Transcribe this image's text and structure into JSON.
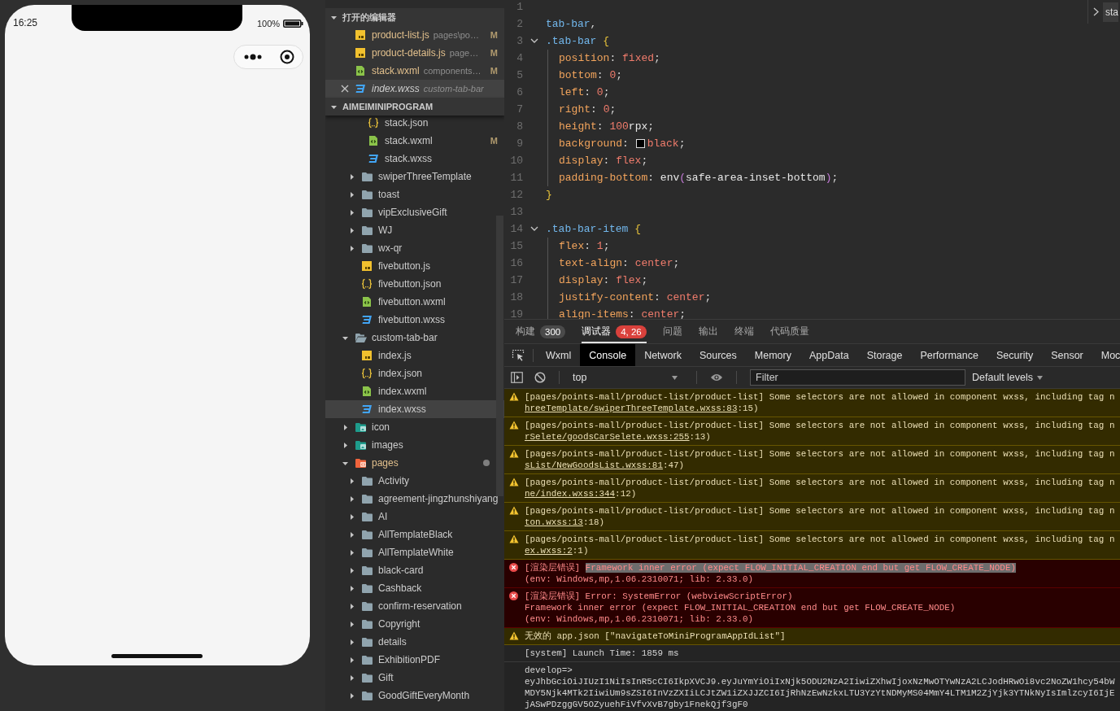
{
  "simulator": {
    "time": "16:25",
    "battery": "100%"
  },
  "explorer": {
    "open_editors": {
      "title": "打开的编辑器",
      "expanded": true,
      "files": [
        {
          "name": "product-list.js",
          "path": "pages\\po…",
          "kind": "js",
          "status": "M",
          "preview": false,
          "selected": false
        },
        {
          "name": "product-details.js",
          "path": "page…",
          "kind": "js",
          "status": "M",
          "preview": false,
          "selected": false
        },
        {
          "name": "stack.wxml",
          "path": "components…",
          "kind": "wxml",
          "status": "M",
          "preview": false,
          "selected": false
        },
        {
          "name": "index.wxss",
          "path": "custom-tab-bar",
          "kind": "wxss",
          "preview": true,
          "selected": true
        }
      ]
    },
    "project": {
      "title": "AIMEIMINIPROGRAM",
      "expanded": true,
      "tree": [
        {
          "children": [
            {
              "children": [
                {
                  "name": "stack.json",
                  "kind": "json",
                  "selected": false
                },
                {
                  "name": "stack.wxml",
                  "kind": "wxml",
                  "status": "M",
                  "selected": false
                },
                {
                  "name": "stack.wxss",
                  "kind": "wxss",
                  "selected": false
                }
              ]
            },
            {
              "name": "swiperThreeTemplate",
              "kind": "folder",
              "expanded": false,
              "selected": false
            },
            {
              "name": "toast",
              "kind": "folder",
              "expanded": false,
              "selected": false
            },
            {
              "name": "vipExclusiveGift",
              "kind": "folder",
              "expanded": false,
              "selected": false
            },
            {
              "name": "WJ",
              "kind": "folder",
              "expanded": false,
              "selected": false
            },
            {
              "name": "wx-qr",
              "kind": "folder",
              "expanded": false,
              "selected": false
            },
            {
              "name": "fivebutton.js",
              "kind": "js",
              "selected": false
            },
            {
              "name": "fivebutton.json",
              "kind": "json",
              "selected": false
            },
            {
              "name": "fivebutton.wxml",
              "kind": "wxml",
              "selected": false
            },
            {
              "name": "fivebutton.wxss",
              "kind": "wxss",
              "selected": false
            }
          ]
        },
        {
          "name": "custom-tab-bar",
          "kind": "folder",
          "expanded": true,
          "selected": false,
          "children": [
            {
              "name": "index.js",
              "kind": "js",
              "selected": false
            },
            {
              "name": "index.json",
              "kind": "json",
              "selected": false
            },
            {
              "name": "index.wxml",
              "kind": "wxml",
              "selected": false
            },
            {
              "name": "index.wxss",
              "kind": "wxss",
              "selected": true
            }
          ]
        },
        {
          "name": "icon",
          "kind": "folder-images",
          "expanded": false,
          "selected": false
        },
        {
          "name": "images",
          "kind": "folder-images",
          "expanded": false,
          "selected": false
        },
        {
          "name": "pages",
          "kind": "folder-pages",
          "expanded": true,
          "changed": true,
          "selected": false,
          "children": [
            {
              "name": "Activity",
              "kind": "folder",
              "expanded": false,
              "selected": false
            },
            {
              "name": "agreement-jingzhunshiyang",
              "kind": "folder",
              "expanded": false,
              "selected": false
            },
            {
              "name": "AI",
              "kind": "folder",
              "expanded": false,
              "selected": false
            },
            {
              "name": "AllTemplateBlack",
              "kind": "folder",
              "expanded": false,
              "selected": false
            },
            {
              "name": "AllTemplateWhite",
              "kind": "folder",
              "expanded": false,
              "selected": false
            },
            {
              "name": "black-card",
              "kind": "folder",
              "expanded": false,
              "selected": false
            },
            {
              "name": "Cashback",
              "kind": "folder",
              "expanded": false,
              "selected": false
            },
            {
              "name": "confirm-reservation",
              "kind": "folder",
              "expanded": false,
              "selected": false
            },
            {
              "name": "Copyright",
              "kind": "folder",
              "expanded": false,
              "selected": false
            },
            {
              "name": "details",
              "kind": "folder",
              "expanded": false,
              "selected": false
            },
            {
              "name": "ExhibitionPDF",
              "kind": "folder",
              "expanded": false,
              "selected": false
            },
            {
              "name": "Gift",
              "kind": "folder",
              "expanded": false,
              "selected": false
            },
            {
              "name": "GoodGiftEveryMonth",
              "kind": "folder",
              "expanded": false,
              "selected": false
            }
          ]
        }
      ]
    }
  },
  "editor": {
    "breadcrumb": "sta",
    "lines": [
      {
        "number": "1",
        "fold": false,
        "kind": "top"
      },
      {
        "number": "2",
        "fold": false,
        "kind": "top",
        "tokens": [
          {
            "kind": "selector",
            "text": "tab-bar"
          },
          {
            "kind": "punct",
            "text": ","
          }
        ]
      },
      {
        "number": "3",
        "fold": true,
        "kind": "top",
        "tokens": [
          {
            "kind": "selector",
            "text": ".tab-bar "
          },
          {
            "kind": "brace",
            "text": "{"
          }
        ]
      },
      {
        "number": "4",
        "fold": false,
        "kind": "nested",
        "tokens": [
          {
            "kind": "prop",
            "text": "position"
          },
          {
            "kind": "punct",
            "text": ": "
          },
          {
            "kind": "value",
            "text": "fixed"
          },
          {
            "kind": "punct",
            "text": ";"
          }
        ]
      },
      {
        "number": "5",
        "fold": false,
        "kind": "nested",
        "tokens": [
          {
            "kind": "prop",
            "text": "bottom"
          },
          {
            "kind": "punct",
            "text": ": "
          },
          {
            "kind": "value",
            "text": "0"
          },
          {
            "kind": "punct",
            "text": ";"
          }
        ]
      },
      {
        "number": "6",
        "fold": false,
        "kind": "nested",
        "tokens": [
          {
            "kind": "prop",
            "text": "left"
          },
          {
            "kind": "punct",
            "text": ": "
          },
          {
            "kind": "value",
            "text": "0"
          },
          {
            "kind": "punct",
            "text": ";"
          }
        ]
      },
      {
        "number": "7",
        "fold": false,
        "kind": "nested",
        "tokens": [
          {
            "kind": "prop",
            "text": "right"
          },
          {
            "kind": "punct",
            "text": ": "
          },
          {
            "kind": "value",
            "text": "0"
          },
          {
            "kind": "punct",
            "text": ";"
          }
        ]
      },
      {
        "number": "8",
        "fold": false,
        "kind": "nested",
        "tokens": [
          {
            "kind": "prop",
            "text": "height"
          },
          {
            "kind": "punct",
            "text": ": "
          },
          {
            "kind": "value",
            "text": "100"
          },
          {
            "kind": "plain",
            "text": "rpx"
          },
          {
            "kind": "punct",
            "text": ";"
          }
        ]
      },
      {
        "number": "9",
        "fold": false,
        "kind": "nested",
        "tokens": [
          {
            "kind": "prop",
            "text": "background"
          },
          {
            "kind": "punct",
            "text": ": "
          },
          {
            "kind": "swatch",
            "color": "#000000"
          },
          {
            "kind": "value",
            "text": "black"
          },
          {
            "kind": "punct",
            "text": ";"
          }
        ]
      },
      {
        "number": "10",
        "fold": false,
        "kind": "nested",
        "tokens": [
          {
            "kind": "prop",
            "text": "display"
          },
          {
            "kind": "punct",
            "text": ": "
          },
          {
            "kind": "value",
            "text": "flex"
          },
          {
            "kind": "punct",
            "text": ";"
          }
        ]
      },
      {
        "number": "11",
        "fold": false,
        "kind": "nested",
        "tokens": [
          {
            "kind": "prop",
            "text": "padding-bottom"
          },
          {
            "kind": "punct",
            "text": ": "
          },
          {
            "kind": "plain",
            "text": "env"
          },
          {
            "kind": "paren",
            "text": "("
          },
          {
            "kind": "plain",
            "text": "safe-area-inset-bottom"
          },
          {
            "kind": "paren",
            "text": ")"
          },
          {
            "kind": "punct",
            "text": ";"
          }
        ]
      },
      {
        "number": "12",
        "fold": false,
        "kind": "top",
        "tokens": [
          {
            "kind": "brace",
            "text": "}"
          }
        ]
      },
      {
        "number": "13",
        "fold": false,
        "kind": "top"
      },
      {
        "number": "14",
        "fold": true,
        "kind": "top",
        "tokens": [
          {
            "kind": "selector",
            "text": ".tab-bar-item "
          },
          {
            "kind": "brace",
            "text": "{"
          }
        ]
      },
      {
        "number": "15",
        "fold": false,
        "kind": "nested",
        "tokens": [
          {
            "kind": "prop",
            "text": "flex"
          },
          {
            "kind": "punct",
            "text": ": "
          },
          {
            "kind": "value",
            "text": "1"
          },
          {
            "kind": "punct",
            "text": ";"
          }
        ]
      },
      {
        "number": "16",
        "fold": false,
        "kind": "nested",
        "tokens": [
          {
            "kind": "prop",
            "text": "text-align"
          },
          {
            "kind": "punct",
            "text": ": "
          },
          {
            "kind": "value",
            "text": "center"
          },
          {
            "kind": "punct",
            "text": ";"
          }
        ]
      },
      {
        "number": "17",
        "fold": false,
        "kind": "nested",
        "tokens": [
          {
            "kind": "prop",
            "text": "display"
          },
          {
            "kind": "punct",
            "text": ": "
          },
          {
            "kind": "value",
            "text": "flex"
          },
          {
            "kind": "punct",
            "text": ";"
          }
        ]
      },
      {
        "number": "18",
        "fold": false,
        "kind": "nested",
        "tokens": [
          {
            "kind": "prop",
            "text": "justify-content"
          },
          {
            "kind": "punct",
            "text": ": "
          },
          {
            "kind": "value",
            "text": "center"
          },
          {
            "kind": "punct",
            "text": ";"
          }
        ]
      },
      {
        "number": "19",
        "fold": false,
        "kind": "nested",
        "tokens": [
          {
            "kind": "prop",
            "text": "align-items"
          },
          {
            "kind": "punct",
            "text": ": "
          },
          {
            "kind": "value",
            "text": "center"
          },
          {
            "kind": "punct",
            "text": ";"
          }
        ]
      }
    ]
  },
  "panel": {
    "tabs": [
      {
        "label": "构建",
        "badge": "300",
        "color": "#4a4a4a",
        "selected": false
      },
      {
        "label": "调试器",
        "badge": "4, 26",
        "color": "#d9413c",
        "selected": true
      },
      {
        "label": "问题",
        "selected": false
      },
      {
        "label": "输出",
        "selected": false
      },
      {
        "label": "终端",
        "selected": false
      },
      {
        "label": "代码质量",
        "selected": false
      }
    ],
    "devtools_tabs": [
      {
        "label": "Wxml",
        "selected": false
      },
      {
        "label": "Console",
        "selected": true
      },
      {
        "label": "Network",
        "selected": false
      },
      {
        "label": "Sources",
        "selected": false
      },
      {
        "label": "Memory",
        "selected": false
      },
      {
        "label": "AppData",
        "selected": false
      },
      {
        "label": "Storage",
        "selected": false
      },
      {
        "label": "Performance",
        "selected": false
      },
      {
        "label": "Security",
        "selected": false
      },
      {
        "label": "Sensor",
        "selected": false
      },
      {
        "label": "Moc",
        "selected": false
      }
    ],
    "toolbar": {
      "context": "top",
      "filter_placeholder": "Filter",
      "levels": "Default levels"
    },
    "messages": [
      {
        "kind": "warning",
        "lines": [
          [
            {
              "kind": "text",
              "text": "[pages/points-mall/product-list/product-list] Some selectors are not allowed in component wxss, including tag n"
            }
          ],
          [
            {
              "kind": "link",
              "text": "hreeTemplate/swiperThreeTemplate.wxss:83"
            },
            {
              "kind": "text",
              "text": ":15)"
            }
          ]
        ]
      },
      {
        "kind": "warning",
        "lines": [
          [
            {
              "kind": "text",
              "text": "[pages/points-mall/product-list/product-list] Some selectors are not allowed in component wxss, including tag n"
            }
          ],
          [
            {
              "kind": "link",
              "text": "rSelete/goodsCarSelete.wxss:255"
            },
            {
              "kind": "text",
              "text": ":13)"
            }
          ]
        ]
      },
      {
        "kind": "warning",
        "lines": [
          [
            {
              "kind": "text",
              "text": "[pages/points-mall/product-list/product-list] Some selectors are not allowed in component wxss, including tag n"
            }
          ],
          [
            {
              "kind": "link",
              "text": "sList/NewGoodsList.wxss:81"
            },
            {
              "kind": "text",
              "text": ":47)"
            }
          ]
        ]
      },
      {
        "kind": "warning",
        "lines": [
          [
            {
              "kind": "text",
              "text": "[pages/points-mall/product-list/product-list] Some selectors are not allowed in component wxss, including tag n"
            }
          ],
          [
            {
              "kind": "link",
              "text": "ne/index.wxss:344"
            },
            {
              "kind": "text",
              "text": ":12)"
            }
          ]
        ]
      },
      {
        "kind": "warning",
        "lines": [
          [
            {
              "kind": "text",
              "text": "[pages/points-mall/product-list/product-list] Some selectors are not allowed in component wxss, including tag n"
            }
          ],
          [
            {
              "kind": "link",
              "text": "ton.wxss:13"
            },
            {
              "kind": "text",
              "text": ":18)"
            }
          ]
        ]
      },
      {
        "kind": "warning",
        "lines": [
          [
            {
              "kind": "text",
              "text": "[pages/points-mall/product-list/product-list] Some selectors are not allowed in component wxss, including tag n"
            }
          ],
          [
            {
              "kind": "link",
              "text": "ex.wxss:2"
            },
            {
              "kind": "text",
              "text": ":1)"
            }
          ]
        ]
      },
      {
        "kind": "error",
        "lines": [
          [
            {
              "kind": "text",
              "text": "[渲染层错误] "
            },
            {
              "kind": "selection",
              "text": "Framework inner error (expect FLOW_INITIAL_CREATION end but get FLOW_CREATE_NODE)"
            }
          ],
          [
            {
              "kind": "text",
              "text": "(env: Windows,mp,1.06.2310071; lib: 2.33.0)"
            }
          ]
        ]
      },
      {
        "kind": "error",
        "lines": [
          [
            {
              "kind": "text",
              "text": "[渲染层错误] Error: SystemError (webviewScriptError)"
            }
          ],
          [
            {
              "kind": "text",
              "text": "Framework inner error (expect FLOW_INITIAL_CREATION end but get FLOW_CREATE_NODE)"
            }
          ],
          [
            {
              "kind": "text",
              "text": "(env: Windows,mp,1.06.2310071; lib: 2.33.0)"
            }
          ]
        ]
      },
      {
        "kind": "warning",
        "lines": [
          [
            {
              "kind": "text",
              "text": "无效的 app.json [\"navigateToMiniProgramAppIdList\"]"
            }
          ]
        ]
      },
      {
        "kind": "log",
        "lines": [
          [
            {
              "kind": "text",
              "text": "[system] Launch Time: 1859 ms"
            }
          ]
        ]
      },
      {
        "kind": "log",
        "lines": [
          [
            {
              "kind": "text",
              "text": "develop=>"
            }
          ],
          [
            {
              "kind": "text",
              "text": "eyJhbGciOiJIUzI1NiIsInR5cCI6IkpXVCJ9.eyJuYmYiOiIxNjk5ODU2NzA2IiwiZXhwIjoxNzMwOTYwNzA2LCJodHRwOi8vc2NoZW1hcy54bW"
            }
          ],
          [
            {
              "kind": "text",
              "text": "MDY5Njk4MTk2IiwiUm9sZSI6InVzZXIiLCJtZW1iZXJJZCI6IjRhNzEwNzkxLTU3YzYtNDMyMS04MmY4LTM1M2ZjYjk3YTNkNyIsImlzcyI6IjE"
            }
          ],
          [
            {
              "kind": "text",
              "text": "jASwPDzggGV5OZyuehFiVfvXvB7gby1FnekQjf3gF0"
            }
          ]
        ]
      }
    ]
  }
}
